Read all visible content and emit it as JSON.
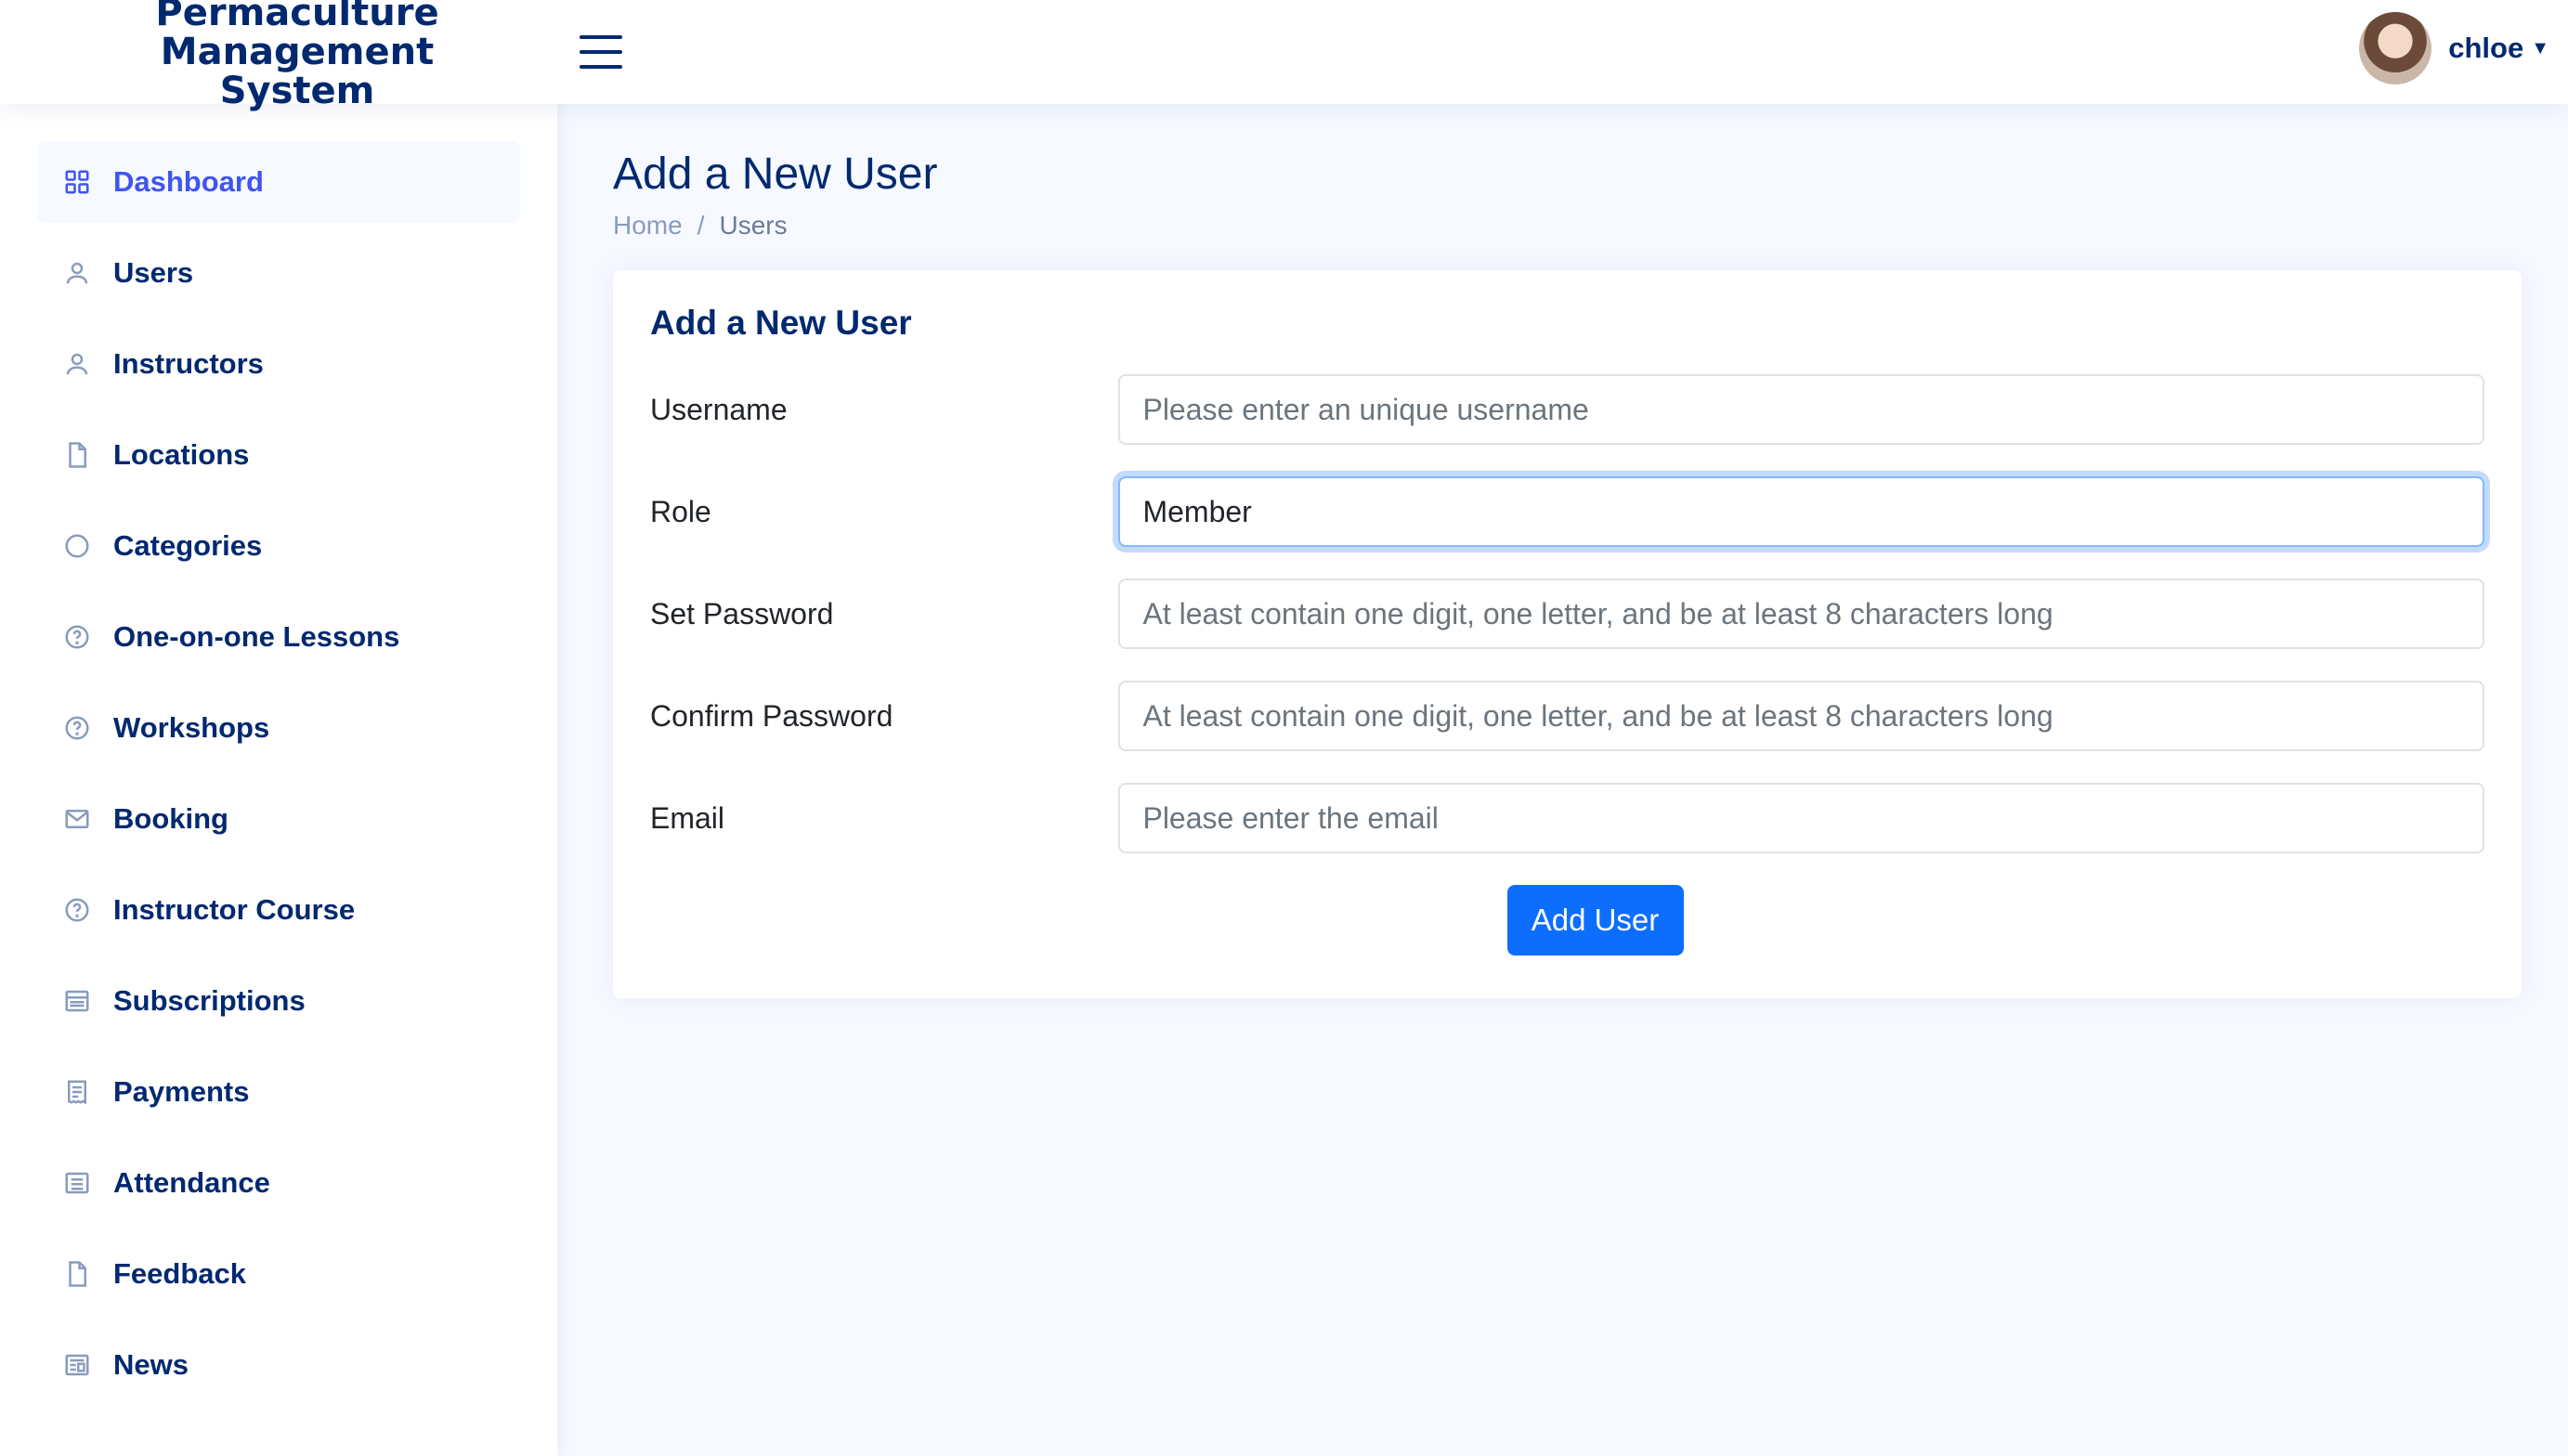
{
  "header": {
    "logo_line1": "Permaculture Management",
    "logo_line2": "System",
    "user_name": "chloe"
  },
  "sidebar": {
    "items": [
      {
        "label": "Dashboard",
        "icon": "grid-icon",
        "active": true
      },
      {
        "label": "Users",
        "icon": "person-icon"
      },
      {
        "label": "Instructors",
        "icon": "person-icon"
      },
      {
        "label": "Locations",
        "icon": "file-icon"
      },
      {
        "label": "Categories",
        "icon": "circle-icon"
      },
      {
        "label": "One-on-one Lessons",
        "icon": "question-circle-icon"
      },
      {
        "label": "Workshops",
        "icon": "question-circle-icon"
      },
      {
        "label": "Booking",
        "icon": "envelope-icon"
      },
      {
        "label": "Instructor Course",
        "icon": "question-circle-icon"
      },
      {
        "label": "Subscriptions",
        "icon": "card-list-icon"
      },
      {
        "label": "Payments",
        "icon": "receipt-icon"
      },
      {
        "label": "Attendance",
        "icon": "list-icon"
      },
      {
        "label": "Feedback",
        "icon": "file-icon"
      },
      {
        "label": "News",
        "icon": "newspaper-icon"
      }
    ]
  },
  "page": {
    "title": "Add a New User",
    "breadcrumb_home": "Home",
    "breadcrumb_sep": "/",
    "breadcrumb_current": "Users"
  },
  "form": {
    "title": "Add a New User",
    "username_label": "Username",
    "username_placeholder": "Please enter an unique username",
    "role_label": "Role",
    "role_value": "Member",
    "password_label": "Set Password",
    "password_placeholder": "At least contain one digit, one letter, and be at least 8 characters long",
    "confirm_label": "Confirm Password",
    "confirm_placeholder": "At least contain one digit, one letter, and be at least 8 characters long",
    "email_label": "Email",
    "email_placeholder": "Please enter the email",
    "submit_label": "Add User"
  },
  "colors": {
    "primary": "#0d6efd",
    "navy": "#012970",
    "active": "#4154f1",
    "background": "#f6f9ff"
  }
}
